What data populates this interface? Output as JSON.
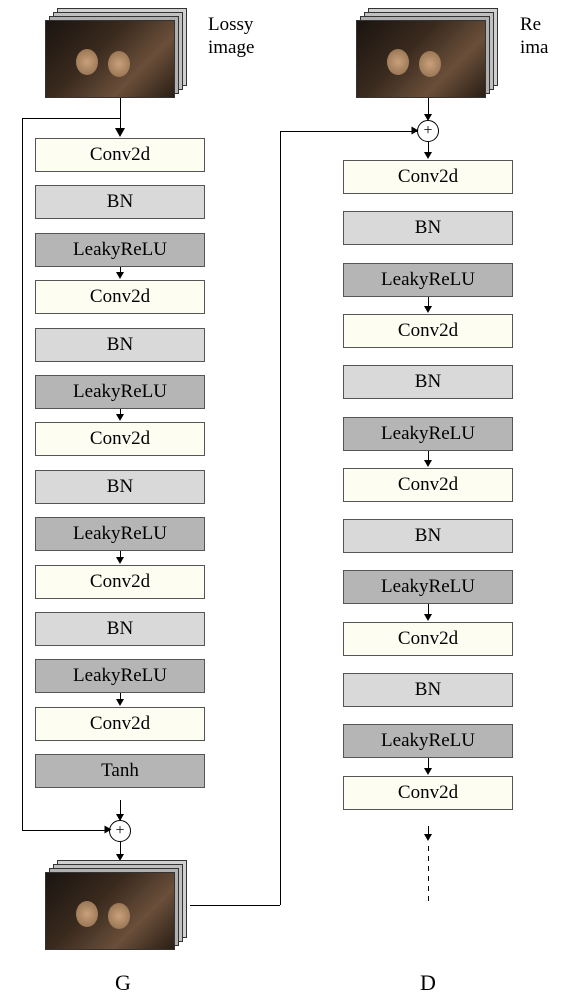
{
  "labels": {
    "lossy": "Lossy\nimage",
    "re_ima": "Re\nima"
  },
  "generator": {
    "name": "G",
    "layers": [
      {
        "text": "Conv2d",
        "color": "lightyellow"
      },
      {
        "text": "BN",
        "color": "gray"
      },
      {
        "text": "LeakyReLU",
        "color": "midgray"
      },
      {
        "text": "Conv2d",
        "color": "lightyellow"
      },
      {
        "text": "BN",
        "color": "gray"
      },
      {
        "text": "LeakyReLU",
        "color": "midgray"
      },
      {
        "text": "Conv2d",
        "color": "lightyellow"
      },
      {
        "text": "BN",
        "color": "gray"
      },
      {
        "text": "LeakyReLU",
        "color": "midgray"
      },
      {
        "text": "Conv2d",
        "color": "lightyellow"
      },
      {
        "text": "BN",
        "color": "gray"
      },
      {
        "text": "LeakyReLU",
        "color": "midgray"
      },
      {
        "text": "Conv2d",
        "color": "lightyellow"
      },
      {
        "text": "Tanh",
        "color": "midgray"
      }
    ]
  },
  "discriminator": {
    "name": "D",
    "layers": [
      {
        "text": "Conv2d",
        "color": "lightyellow"
      },
      {
        "text": "BN",
        "color": "gray"
      },
      {
        "text": "LeakyReLU",
        "color": "midgray"
      },
      {
        "text": "Conv2d",
        "color": "lightyellow"
      },
      {
        "text": "BN",
        "color": "gray"
      },
      {
        "text": "LeakyReLU",
        "color": "midgray"
      },
      {
        "text": "Conv2d",
        "color": "lightyellow"
      },
      {
        "text": "BN",
        "color": "gray"
      },
      {
        "text": "LeakyReLU",
        "color": "midgray"
      },
      {
        "text": "Conv2d",
        "color": "lightyellow"
      },
      {
        "text": "BN",
        "color": "gray"
      },
      {
        "text": "LeakyReLU",
        "color": "midgray"
      },
      {
        "text": "Conv2d",
        "color": "lightyellow"
      }
    ]
  },
  "chart_data": {
    "type": "diagram",
    "description": "Two-branch neural network architecture. Left branch (G, generator) takes a lossy image, passes through repeated Conv2d-BN-LeakyReLU blocks (4 repeats) then Conv2d+Tanh, with a skip connection adding the input lossy image to the output. Right branch (D, discriminator) takes a reference image and the generated image summed together, then passes through repeated Conv2d-BN-LeakyReLU blocks (4 repeats) then a final Conv2d, with output continuing (dashed arrow).",
    "nodes": {
      "G": [
        "Conv2d",
        "BN",
        "LeakyReLU",
        "Conv2d",
        "BN",
        "LeakyReLU",
        "Conv2d",
        "BN",
        "LeakyReLU",
        "Conv2d",
        "BN",
        "LeakyReLU",
        "Conv2d",
        "Tanh"
      ],
      "D": [
        "Conv2d",
        "BN",
        "LeakyReLU",
        "Conv2d",
        "BN",
        "LeakyReLU",
        "Conv2d",
        "BN",
        "LeakyReLU",
        "Conv2d",
        "BN",
        "LeakyReLU",
        "Conv2d"
      ]
    },
    "inputs": {
      "G": "Lossy image",
      "D": "Re[ference] ima[ge]"
    },
    "skip_connections": [
      {
        "from": "G input",
        "to": "G output",
        "op": "add"
      },
      {
        "from": "G output",
        "to": "D input",
        "op": "add with Re image"
      }
    ]
  }
}
